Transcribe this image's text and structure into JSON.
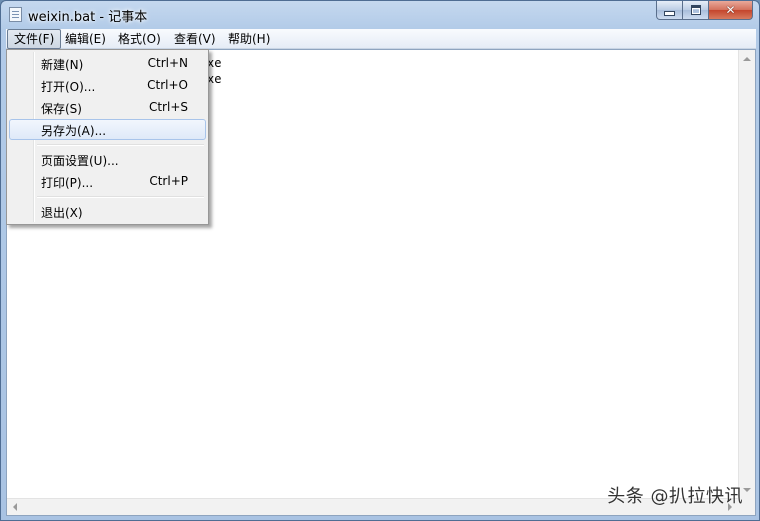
{
  "window": {
    "title": "weixin.bat - 记事本"
  },
  "menubar": {
    "items": [
      {
        "label": "文件(F)"
      },
      {
        "label": "编辑(E)"
      },
      {
        "label": "格式(O)"
      },
      {
        "label": "查看(V)"
      },
      {
        "label": "帮助(H)"
      }
    ]
  },
  "file_menu": {
    "items": [
      {
        "label": "新建(N)",
        "shortcut": "Ctrl+N"
      },
      {
        "label": "打开(O)...",
        "shortcut": "Ctrl+O"
      },
      {
        "label": "保存(S)",
        "shortcut": "Ctrl+S"
      },
      {
        "label": "另存为(A)...",
        "shortcut": ""
      },
      {
        "label": "页面设置(U)...",
        "shortcut": ""
      },
      {
        "label": "打印(P)...",
        "shortcut": "Ctrl+P"
      },
      {
        "label": "退出(X)",
        "shortcut": ""
      }
    ],
    "highlighted": "另存为(A)..."
  },
  "editor": {
    "lines": [
      "xe",
      "xe"
    ]
  },
  "watermark": "头条 @扒拉快讯"
}
